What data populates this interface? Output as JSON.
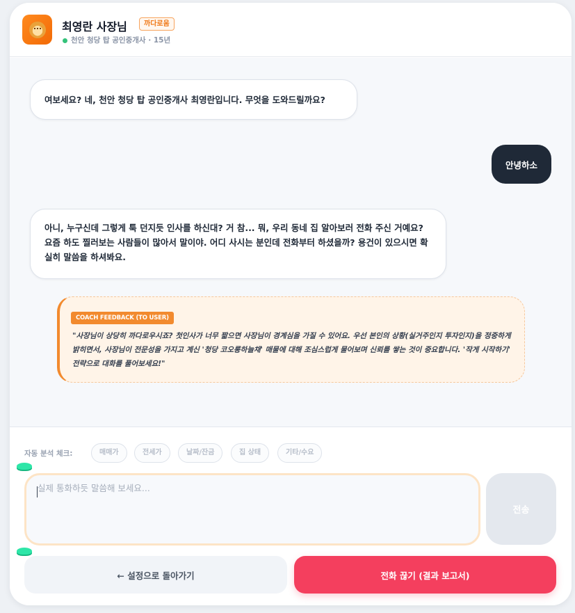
{
  "header": {
    "name": "최영란 사장님",
    "badge": "까다로움",
    "subtitle": "천안 청당 탑 공인중개사 · 15년"
  },
  "messages": [
    {
      "role": "agent",
      "text": "여보세요? 네, 천안 청당 탑 공인중개사 최영란입니다. 무엇을 도와드릴까요?"
    },
    {
      "role": "user",
      "text": "안녕하소"
    },
    {
      "role": "agent",
      "text": "아니, 누구신데 그렇게 툭 던지듯 인사를 하신대? 거 참... 뭐, 우리 동네 집 알아보러 전화 주신 거예요? 요즘 하도 찔러보는 사람들이 많아서 말이야. 어디 사시는 분인데 전화부터 하셨을까? 용건이 있으시면 확실히 말씀을 하셔봐요."
    }
  ],
  "coach": {
    "tag": "COACH FEEDBACK (TO USER)",
    "text": "\"사장님이 상당히 까다로우시죠? 첫인사가 너무 짧으면 사장님이 경계심을 가질 수 있어요. 우선 본인의 상황(실거주인지 투자인지)을 정중하게 밝히면서, 사장님이 전문성을 가지고 계신 '청당 코오롱하늘채' 매물에 대해 조심스럽게 물어보며 신뢰를 쌓는 것이 중요합니다. '작게 시작하기' 전략으로 대화를 풀어보세요!\""
  },
  "analysis": {
    "label": "자동 분석 체크:",
    "chips": [
      "매매가",
      "전세가",
      "날짜/잔금",
      "집 상태",
      "기타/수요"
    ]
  },
  "input": {
    "placeholder": "실제 통화하듯 말씀해 보세요...",
    "send_label": "전송"
  },
  "actions": {
    "back_label": "← 설정으로 돌아가기",
    "end_label": "전화 끊기 (결과 보고서)"
  },
  "colors": {
    "accent_orange": "#f28a2e",
    "end_call_red": "#f43f5e",
    "user_bubble": "#1f2937"
  }
}
